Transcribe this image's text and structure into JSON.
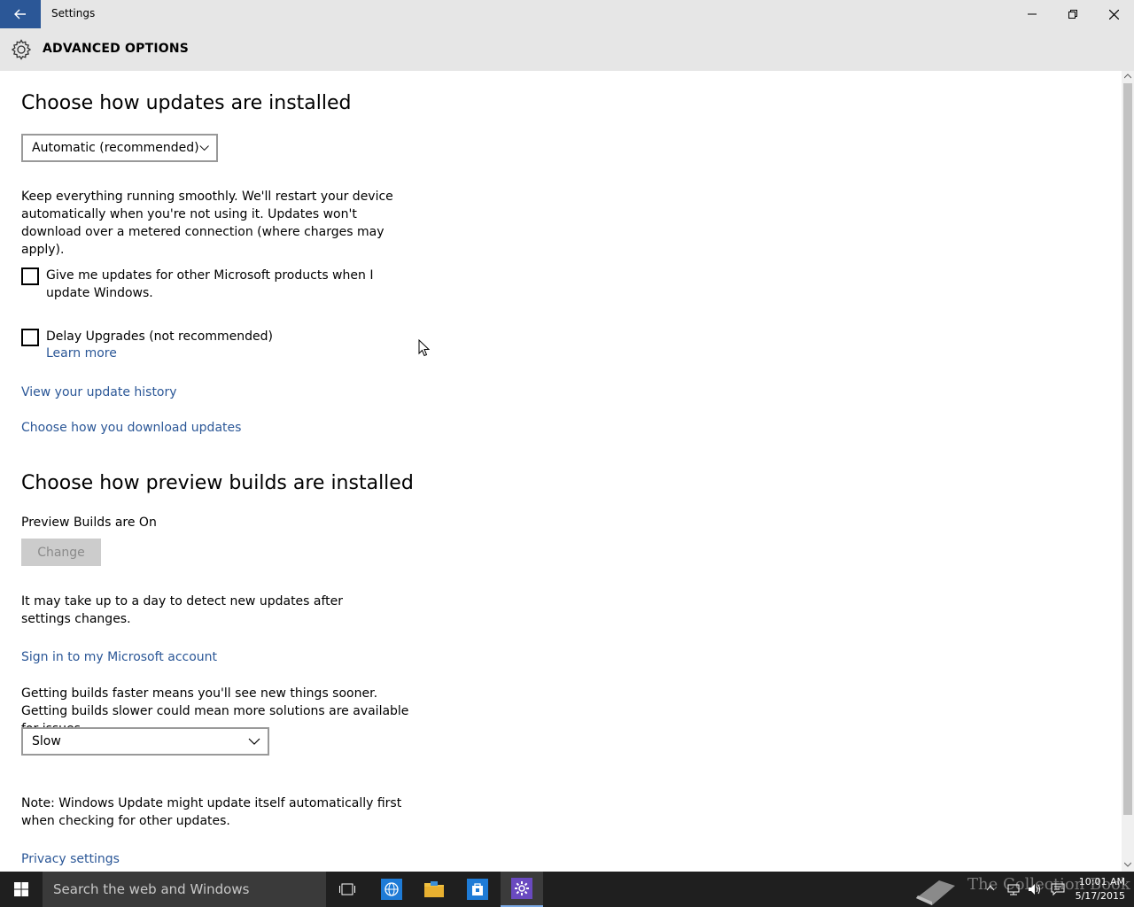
{
  "window": {
    "title": "Settings",
    "controls": [
      "minimize-icon",
      "restore-icon",
      "close-icon"
    ]
  },
  "header": {
    "title": "ADVANCED OPTIONS",
    "icon": "gear-icon"
  },
  "updates": {
    "heading": "Choose how updates are installed",
    "mode_value": "Automatic (recommended)",
    "description": "Keep everything running smoothly. We'll restart your device automatically when you're not using it. Updates won't download over a metered connection (where charges may apply).",
    "other_products_label": "Give me updates for other Microsoft products when I update Windows.",
    "other_products_checked": false,
    "delay_label": "Delay Upgrades (not recommended)",
    "delay_checked": false,
    "learn_more": "Learn more",
    "history_link": "View your update history",
    "download_link": "Choose how you download updates"
  },
  "preview": {
    "heading": "Choose how preview builds are installed",
    "status": "Preview Builds are On",
    "change_button": "Change",
    "detect_note": "It may take up to a day to detect new updates after settings changes.",
    "signin_link": "Sign in to my Microsoft account",
    "speed_note": "Getting builds faster means you'll see new things sooner. Getting builds slower could mean more solutions are available for issues.",
    "ring_value": "Slow",
    "update_note": "Note: Windows Update might update itself automatically first when checking for other updates.",
    "privacy_link": "Privacy settings"
  },
  "taskbar": {
    "search_placeholder": "Search the web and Windows",
    "watermark": "The Collection Book",
    "time": "10:01 AM",
    "date": "5/17/2015",
    "accent": "#2b5797"
  }
}
